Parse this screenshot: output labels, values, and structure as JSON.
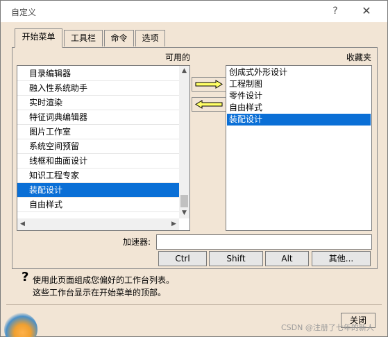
{
  "window": {
    "title": "自定义",
    "help_glyph": "?",
    "close_glyph": "✕"
  },
  "tabs": [
    {
      "label": "开始菜单",
      "active": true
    },
    {
      "label": "工具栏",
      "active": false
    },
    {
      "label": "命令",
      "active": false
    },
    {
      "label": "选项",
      "active": false
    }
  ],
  "available": {
    "label": "可用的",
    "items": [
      {
        "label": "目录编辑器",
        "selected": false
      },
      {
        "label": "融入性系统助手",
        "selected": false
      },
      {
        "label": "实时渲染",
        "selected": false
      },
      {
        "label": "特征词典编辑器",
        "selected": false
      },
      {
        "label": "图片工作室",
        "selected": false
      },
      {
        "label": "系统空间预留",
        "selected": false
      },
      {
        "label": "线框和曲面设计",
        "selected": false
      },
      {
        "label": "知识工程专家",
        "selected": false
      },
      {
        "label": "装配设计",
        "selected": true
      },
      {
        "label": "自由样式",
        "selected": false
      }
    ]
  },
  "favorites": {
    "label": "收藏夹",
    "items": [
      {
        "label": "创成式外形设计",
        "selected": false
      },
      {
        "label": "工程制图",
        "selected": false
      },
      {
        "label": "零件设计",
        "selected": false
      },
      {
        "label": "自由样式",
        "selected": false
      },
      {
        "label": "装配设计",
        "selected": true
      }
    ]
  },
  "transfer": {
    "add_icon": "arrow-right-icon",
    "remove_icon": "arrow-left-icon"
  },
  "accelerator": {
    "label": "加速器:",
    "value": "",
    "buttons": [
      "Ctrl",
      "Shift",
      "Alt",
      "其他..."
    ]
  },
  "help": {
    "icon": "question-icon",
    "line1": "使用此页面组成您偏好的工作台列表。",
    "line2": "这些工作台显示在开始菜单的顶部。"
  },
  "close_label": "关闭",
  "watermark": "CSDN @注册了七年的新人",
  "colors": {
    "dialog_bg": "#f2e5d5",
    "selection": "#0a6fd6",
    "arrow_fill": "#ffff66"
  }
}
